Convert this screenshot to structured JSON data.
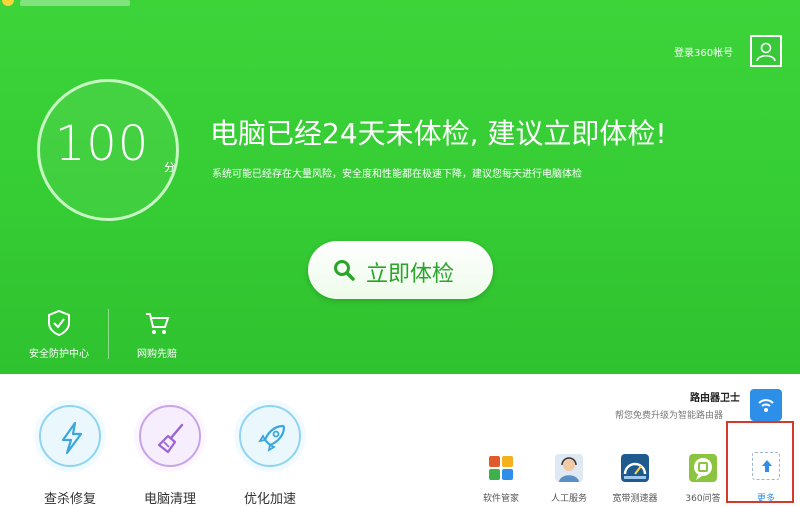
{
  "account": {
    "login_label": "登录360帐号"
  },
  "status": {
    "score": "100",
    "score_unit": "分",
    "headline": "电脑已经24天未体检, 建议立即体检!",
    "subline": "系统可能已经存在大量风险，安全度和性能都在极速下降，建议您每天进行电脑体检"
  },
  "main_button": {
    "label": "立即体检",
    "icon": "search-icon"
  },
  "tools": [
    {
      "label": "安全防护中心",
      "icon": "shield-icon"
    },
    {
      "label": "网购先赔",
      "icon": "cart-icon"
    }
  ],
  "features": [
    {
      "label": "查杀修复",
      "icon": "lightning-icon",
      "color": "#8fd4f0"
    },
    {
      "label": "电脑清理",
      "icon": "broom-icon",
      "color": "#c9a3ea"
    },
    {
      "label": "优化加速",
      "icon": "rocket-icon",
      "color": "#8fd4f0"
    }
  ],
  "router": {
    "title": "路由器卫士",
    "subtitle": "帮您免费升级为智能路由器"
  },
  "apps": [
    {
      "label": "软件管家",
      "icon": "software-manager-icon",
      "color": "#e35a2a"
    },
    {
      "label": "人工服务",
      "icon": "support-agent-icon",
      "color": "#5a8fc4"
    },
    {
      "label": "宽带测速器",
      "icon": "speed-test-icon",
      "color": "#1e5a8e"
    },
    {
      "label": "360问答",
      "icon": "qa-icon",
      "color": "#8bc53f"
    }
  ],
  "more": {
    "label": "更多",
    "icon": "upload-icon"
  },
  "colors": {
    "brand_green": "#35cc34",
    "highlight_red": "#d43a2b",
    "accent_blue": "#2e8fe8"
  }
}
